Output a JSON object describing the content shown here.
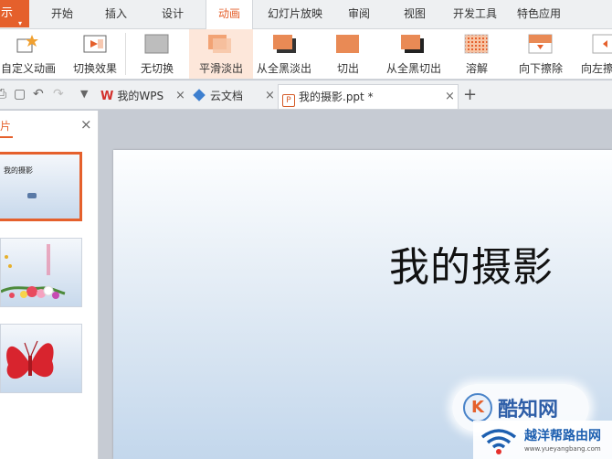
{
  "ribbon": {
    "app_button": "示",
    "tabs": [
      {
        "label": "开始"
      },
      {
        "label": "插入"
      },
      {
        "label": "设计"
      },
      {
        "label": "动画"
      },
      {
        "label": "幻灯片放映"
      },
      {
        "label": "审阅"
      },
      {
        "label": "视图"
      },
      {
        "label": "开发工具"
      },
      {
        "label": "特色应用"
      }
    ],
    "active_tab": "动画",
    "buttons": [
      {
        "label": "自定义动画"
      },
      {
        "label": "切换效果"
      },
      {
        "label": "无切换"
      },
      {
        "label": "平滑淡出"
      },
      {
        "label": "从全黑淡出"
      },
      {
        "label": "切出"
      },
      {
        "label": "从全黑切出"
      },
      {
        "label": "溶解"
      },
      {
        "label": "向下擦除"
      },
      {
        "label": "向左擦"
      }
    ],
    "selected_button": "平滑淡出"
  },
  "doc_tabs": [
    {
      "label": "我的WPS",
      "close": "×"
    },
    {
      "label": "云文档",
      "close": "×"
    },
    {
      "label": "我的摄影.ppt *",
      "close": "×"
    }
  ],
  "new_tab": "+",
  "left_panel": {
    "title": "片",
    "close": "×",
    "thumb1_title": "我的摄影"
  },
  "slide": {
    "title": "我的摄影"
  },
  "watermarks": {
    "w1_icon": "K",
    "w1_text": "酷知网",
    "w2_text": "越洋帮路由网",
    "w2_url": "www.yueyangbang.com"
  },
  "colors": {
    "accent": "#e5602c",
    "slide_gradient_bottom": "#c3d7ec"
  }
}
